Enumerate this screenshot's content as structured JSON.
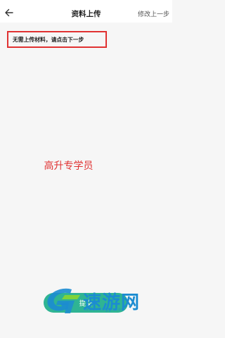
{
  "header": {
    "title": "资料上传",
    "right_action": "修改上一步",
    "back_icon": "arrow-left-icon"
  },
  "notice": {
    "text": "无需上传材料，请点击下一步"
  },
  "content": {
    "major_label": "高升专学员"
  },
  "footer": {
    "submit_label": "提交"
  },
  "watermark": {
    "text": "速游网",
    "url": "www.sugg.com",
    "logo_icon": "watermark-logo-icon"
  },
  "colors": {
    "accent": "#2fb493",
    "highlight": "#e03232",
    "watermark": "#1c8cd1"
  }
}
